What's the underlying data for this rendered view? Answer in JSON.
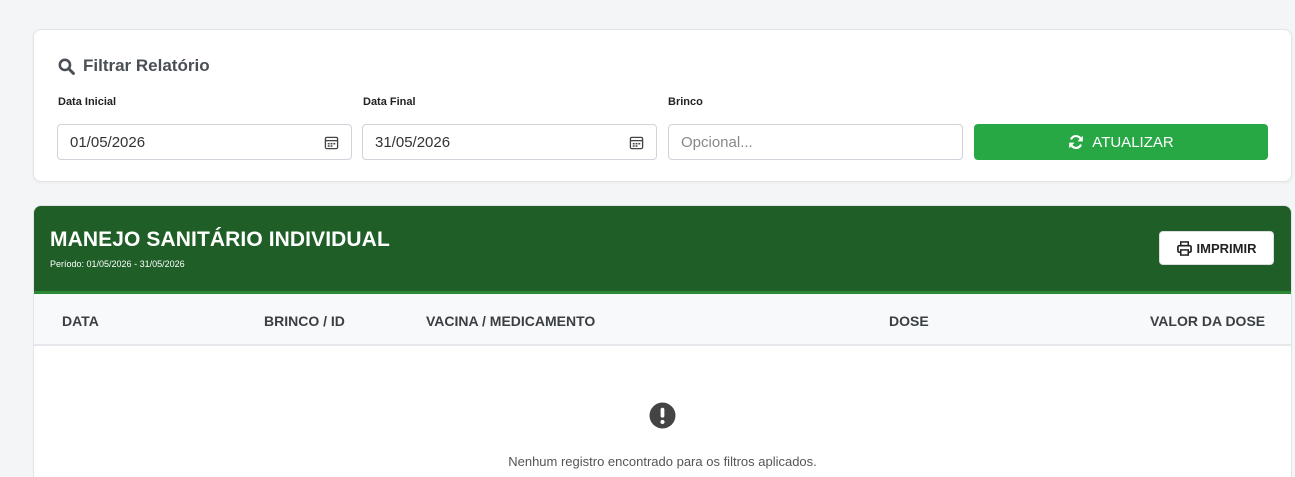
{
  "filter": {
    "title": "Filtrar Relatório",
    "start_label": "Data Inicial",
    "start_value": "01/05/2026",
    "end_label": "Data Final",
    "end_value": "31/05/2026",
    "tag_label": "Brinco",
    "tag_placeholder": "Opcional...",
    "update_label": "ATUALIZAR"
  },
  "report": {
    "title": "MANEJO SANITÁRIO INDIVIDUAL",
    "period": "Período: 01/05/2026 - 31/05/2026",
    "print_label": "IMPRIMIR",
    "columns": [
      "DATA",
      "BRINCO / ID",
      "VACINA / MEDICAMENTO",
      "DOSE",
      "VALOR DA DOSE"
    ],
    "empty_message": "Nenhum registro encontrado para os filtros aplicados."
  },
  "colors": {
    "header_green": "#1f5f27",
    "button_green": "#28a745"
  },
  "icons": {
    "filter_title": "search-icon",
    "date_inputs": "calendar-icon",
    "update_button": "refresh-icon",
    "print_button": "print-icon",
    "empty_state": "exclamation-circle-icon"
  }
}
